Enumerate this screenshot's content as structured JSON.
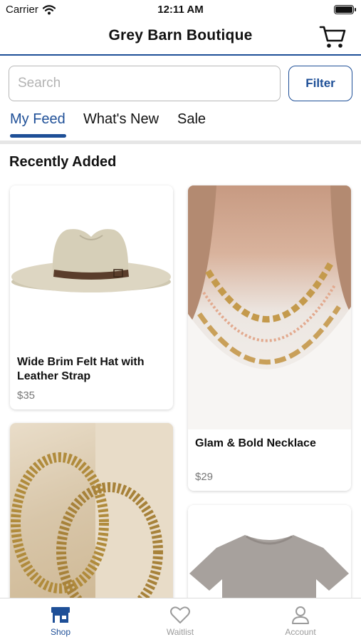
{
  "status_bar": {
    "carrier": "Carrier",
    "time": "12:11 AM"
  },
  "header": {
    "title": "Grey Barn Boutique",
    "cart_icon": "cart-icon"
  },
  "search": {
    "placeholder": "Search",
    "value": "",
    "filter_label": "Filter"
  },
  "tabs": [
    {
      "label": "My Feed",
      "active": true
    },
    {
      "label": "What's New",
      "active": false
    },
    {
      "label": "Sale",
      "active": false
    }
  ],
  "section_title": "Recently Added",
  "products": [
    {
      "title_line1": "Wide Brim Felt Hat with",
      "title_line2": "Leather Strap",
      "price": "$35",
      "image": "hat-image"
    },
    {
      "title_line1": "Glam & Bold Necklace",
      "price": "$29",
      "image": "necklace-image"
    },
    {
      "image": "earrings-image"
    },
    {
      "image": "tshirt-image"
    }
  ],
  "bottom_nav": [
    {
      "label": "Shop",
      "icon": "shop-icon",
      "active": true
    },
    {
      "label": "Waitlist",
      "icon": "heart-icon",
      "active": false
    },
    {
      "label": "Account",
      "icon": "account-icon",
      "active": false
    }
  ],
  "colors": {
    "accent": "#1e4f97",
    "muted": "#9b9b9b",
    "price": "#777777"
  }
}
